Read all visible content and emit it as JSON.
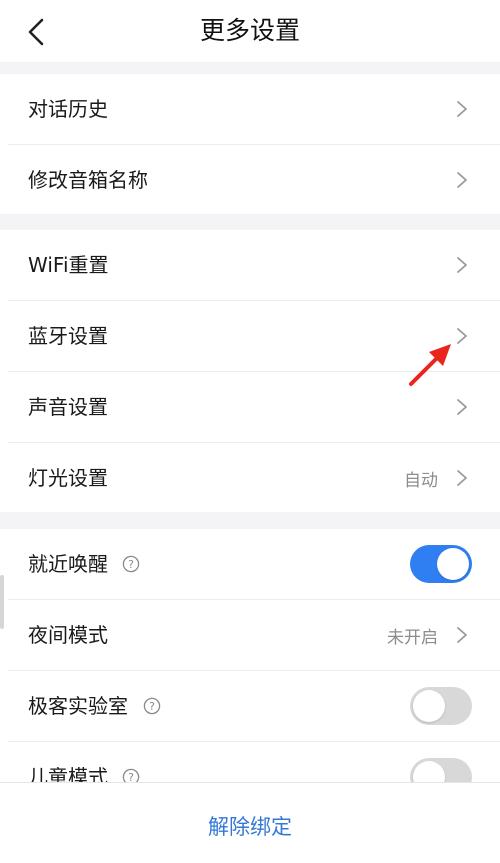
{
  "header": {
    "title": "更多设置",
    "back_icon": "chevron-left-icon"
  },
  "group1": {
    "items": [
      {
        "label": "对话历史",
        "icon": "chevron-right-icon"
      },
      {
        "label": "修改音箱名称",
        "icon": "chevron-right-icon"
      }
    ]
  },
  "group2": {
    "items": [
      {
        "label": "WiFi重置",
        "icon": "chevron-right-icon"
      },
      {
        "label": "蓝牙设置",
        "icon": "chevron-right-icon"
      },
      {
        "label": "声音设置",
        "icon": "chevron-right-icon"
      },
      {
        "label": "灯光设置",
        "value": "自动",
        "icon": "chevron-right-icon"
      }
    ]
  },
  "group3": {
    "items": [
      {
        "label": "就近唤醒",
        "help_icon": "question-circle-icon",
        "toggle": "on"
      },
      {
        "label": "夜间模式",
        "value": "未开启",
        "icon": "chevron-right-icon"
      },
      {
        "label": "极客实验室",
        "help_icon": "question-circle-icon",
        "toggle": "off"
      },
      {
        "label": "儿童模式",
        "help_icon": "question-circle-icon",
        "toggle": "off"
      }
    ]
  },
  "footer": {
    "unbind_label": "解除绑定"
  },
  "colors": {
    "accent": "#2f7ff2",
    "link": "#3478d6",
    "annotation_arrow": "#e8261c",
    "background": "#f4f4f6"
  }
}
